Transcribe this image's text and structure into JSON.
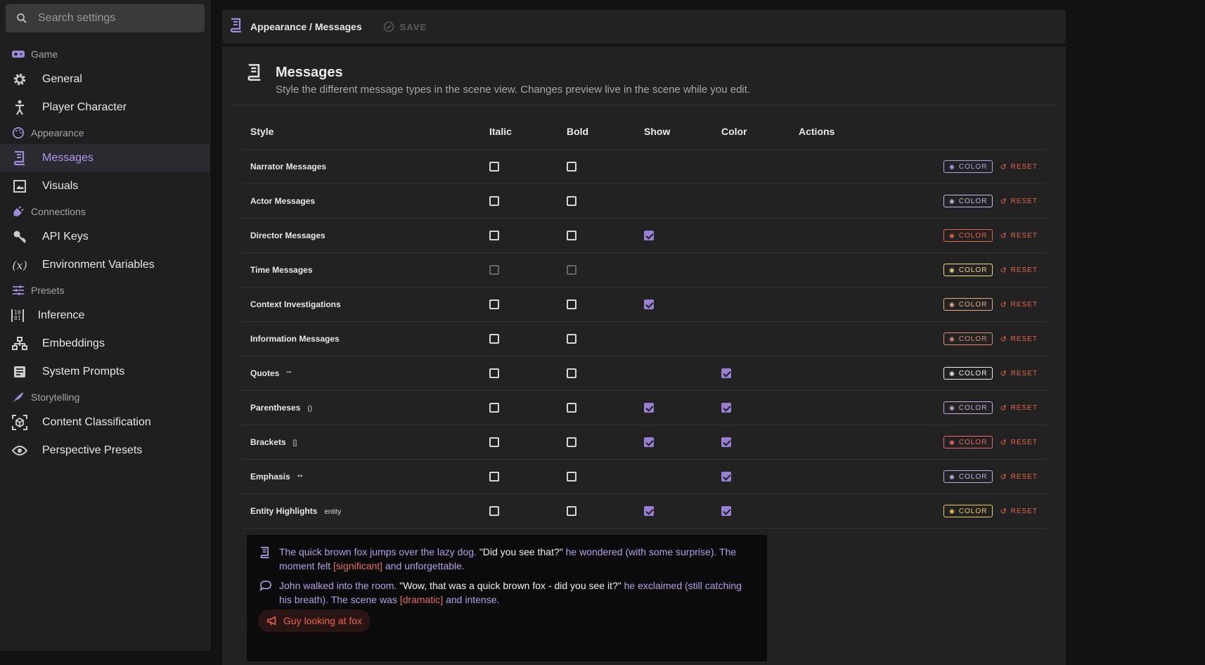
{
  "sidebar": {
    "search_placeholder": "Search settings",
    "sections": [
      {
        "label": "Game",
        "icon": "gamepad-icon"
      },
      {
        "label": "Appearance",
        "icon": "palette-icon"
      },
      {
        "label": "Connections",
        "icon": "plug-icon"
      },
      {
        "label": "Presets",
        "icon": "tune-icon"
      },
      {
        "label": "Storytelling",
        "icon": "feather-icon"
      }
    ],
    "items": [
      {
        "label": "General",
        "icon": "gear-icon"
      },
      {
        "label": "Player Character",
        "icon": "person-icon"
      },
      {
        "label": "Messages",
        "icon": "message-book-icon"
      },
      {
        "label": "Visuals",
        "icon": "image-icon"
      },
      {
        "label": "API Keys",
        "icon": "key-icon"
      },
      {
        "label": "Environment Variables",
        "icon": "variable-icon"
      },
      {
        "label": "Inference",
        "icon": "binary-icon"
      },
      {
        "label": "Embeddings",
        "icon": "network-icon"
      },
      {
        "label": "System Prompts",
        "icon": "document-icon"
      },
      {
        "label": "Content Classification",
        "icon": "cube-scan-icon"
      },
      {
        "label": "Perspective Presets",
        "icon": "eye-icon"
      }
    ]
  },
  "topbar": {
    "breadcrumb": "Appearance / Messages",
    "save_label": "SAVE"
  },
  "panel": {
    "title": "Messages",
    "subtitle": "Style the different message types in the scene view. Changes preview live in the scene while you edit."
  },
  "table": {
    "headers": {
      "style": "Style",
      "italic": "Italic",
      "bold": "Bold",
      "show": "Show",
      "color": "Color",
      "actions": "Actions"
    },
    "color_label": "COLOR",
    "reset_label": "RESET",
    "rows": [
      {
        "name": "Narrator Messages",
        "marker": "",
        "italic": false,
        "bold": false,
        "show": null,
        "color": null,
        "swatch": "#b6a0e8"
      },
      {
        "name": "Actor Messages",
        "marker": "",
        "italic": false,
        "bold": false,
        "show": null,
        "color": null,
        "swatch": "#c8b8ee"
      },
      {
        "name": "Director Messages",
        "marker": "",
        "italic": false,
        "bold": false,
        "show": true,
        "color": null,
        "swatch": "#e8654a"
      },
      {
        "name": "Time Messages",
        "marker": "",
        "italic": false,
        "bold": false,
        "show": null,
        "color": null,
        "swatch": "#f1d98c",
        "dim": true
      },
      {
        "name": "Context Investigations",
        "marker": "",
        "italic": false,
        "bold": false,
        "show": true,
        "color": null,
        "swatch": "#e8b088"
      },
      {
        "name": "Information Messages",
        "marker": "",
        "italic": false,
        "bold": false,
        "show": null,
        "color": null,
        "swatch": "#d89070"
      },
      {
        "name": "Quotes",
        "marker": "\"\"",
        "italic": false,
        "bold": false,
        "show": null,
        "color": true,
        "swatch": "#f0f0f0"
      },
      {
        "name": "Parentheses",
        "marker": "()",
        "italic": false,
        "bold": false,
        "show": true,
        "color": true,
        "swatch": "#c8a8e0"
      },
      {
        "name": "Brackets",
        "marker": "[]",
        "italic": false,
        "bold": false,
        "show": true,
        "color": true,
        "swatch": "#e86a6a"
      },
      {
        "name": "Emphasis",
        "marker": "**",
        "italic": false,
        "bold": false,
        "show": null,
        "color": true,
        "swatch": "#c0b0e8"
      },
      {
        "name": "Entity Highlights",
        "marker": "entity",
        "italic": false,
        "bold": false,
        "show": true,
        "color": true,
        "swatch": "#f0c860"
      }
    ]
  },
  "preview": {
    "line1": {
      "narr1": "The quick brown fox jumps over the lazy dog.",
      "quote": "\"Did you see that?\"",
      "narr2": "he wondered",
      "par": "(with some surprise).",
      "narr3": "The moment felt",
      "brk": "[significant]",
      "narr4": "and unforgettable."
    },
    "line2": {
      "narr1": "John walked into the room.",
      "quote": "\"Wow, that was a quick brown fox - did you see it?\"",
      "narr2": "he exclaimed",
      "par": "(still catching his breath).",
      "narr3": "The scene was",
      "brk": "[dramatic]",
      "narr4": "and intense."
    },
    "chip": "Guy looking at fox"
  },
  "colors": {
    "accent": "#9a7ed4",
    "reset": "#e8654a"
  }
}
